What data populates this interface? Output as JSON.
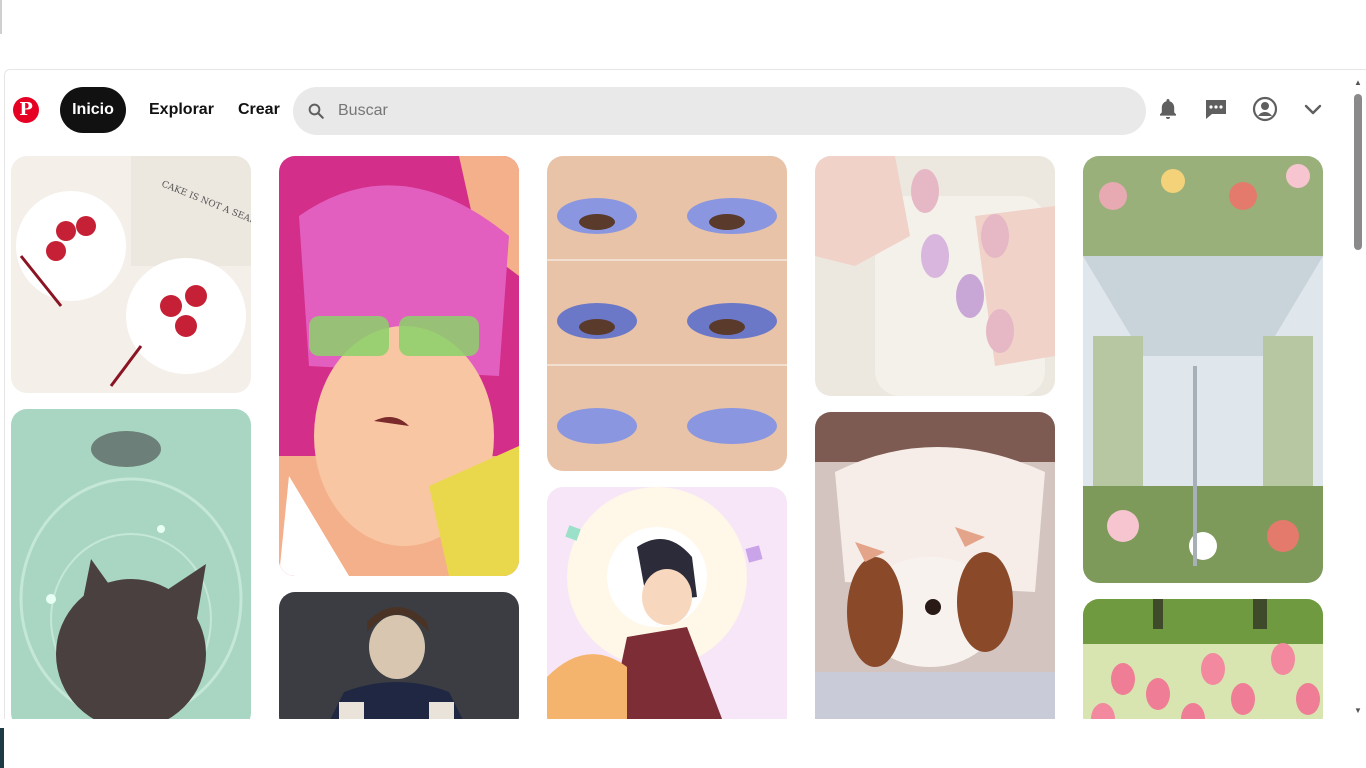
{
  "header": {
    "logo": "P",
    "nav": {
      "home": "Inicio",
      "explore": "Explorar",
      "create": "Crear"
    },
    "search": {
      "placeholder": "Buscar",
      "value": ""
    },
    "icons": [
      "pinterest-logo-icon",
      "search-icon",
      "bell-icon",
      "messages-icon",
      "profile-icon",
      "chevron-down-icon"
    ]
  },
  "pins": [
    {
      "description": "strawberry cakes with red bows",
      "colors": [
        "#f4efe9",
        "#c52035",
        "#ffffff"
      ]
    },
    {
      "description": "anime boy with pink hair and green glasses",
      "colors": [
        "#d32f8a",
        "#f4b08a",
        "#8bd16a"
      ]
    },
    {
      "description": "blue eyeshadow makeup close-ups",
      "colors": [
        "#e8c3a7",
        "#6b78c8",
        "#f3dfcf"
      ]
    },
    {
      "description": "pink nails holding white mug",
      "colors": [
        "#f0d2c8",
        "#c8a7d6",
        "#ece8e0"
      ]
    },
    {
      "description": "bus interior filled with flowers",
      "colors": [
        "#9ab07a",
        "#e7a9b2",
        "#dfe6ec"
      ]
    },
    {
      "description": "black cat in water",
      "colors": [
        "#a9d6c3",
        "#4b4040",
        "#d7f1e4"
      ]
    },
    {
      "description": "young man in jacket portrait",
      "colors": [
        "#3b3d42",
        "#1f2742",
        "#d8c6b1"
      ]
    },
    {
      "description": "anime characters in glowing light",
      "colors": [
        "#f6e6f7",
        "#7c2d35",
        "#f5b46d"
      ]
    },
    {
      "description": "puppy sleeping on blanket",
      "colors": [
        "#d3c4c0",
        "#8a4a2a",
        "#f6ede8"
      ]
    },
    {
      "description": "pink tulips in garden",
      "colors": [
        "#6f9a3f",
        "#ef7d95",
        "#d8e5b0"
      ]
    }
  ]
}
